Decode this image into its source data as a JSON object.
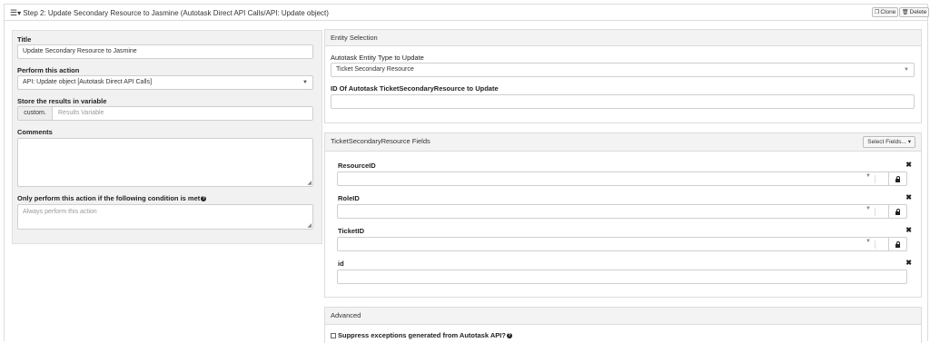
{
  "header": {
    "title": "Step 2: Update Secondary Resource to Jasmine (Autotask Direct API Calls/API: Update object)",
    "clone_label": "Clone",
    "delete_label": "Delete"
  },
  "left": {
    "title_label": "Title",
    "title_value": "Update Secondary Resource to Jasmine",
    "action_label": "Perform this action",
    "action_value": "API: Update object [Autotask Direct API Calls]",
    "store_label": "Store the results in variable",
    "store_prefix": "custom.",
    "store_placeholder": "Results Variable",
    "comments_label": "Comments",
    "comments_value": "",
    "condition_label": "Only perform this action if the following condition is met",
    "condition_placeholder": "Always perform this action"
  },
  "entity": {
    "heading": "Entity Selection",
    "type_label": "Autotask Entity Type to Update",
    "type_value": "Ticket Secondary Resource",
    "id_label": "ID Of Autotask TicketSecondaryResource to Update",
    "id_value": ""
  },
  "fields": {
    "heading": "TicketSecondaryResource Fields",
    "select_button": "Select Fields...",
    "items": [
      {
        "label": "ResourceID",
        "value": ""
      },
      {
        "label": "RoleID",
        "value": ""
      },
      {
        "label": "TicketID",
        "value": ""
      },
      {
        "label": "id",
        "value": ""
      }
    ]
  },
  "advanced": {
    "heading": "Advanced",
    "suppress_label": "Suppress exceptions generated from Autotask API?"
  }
}
